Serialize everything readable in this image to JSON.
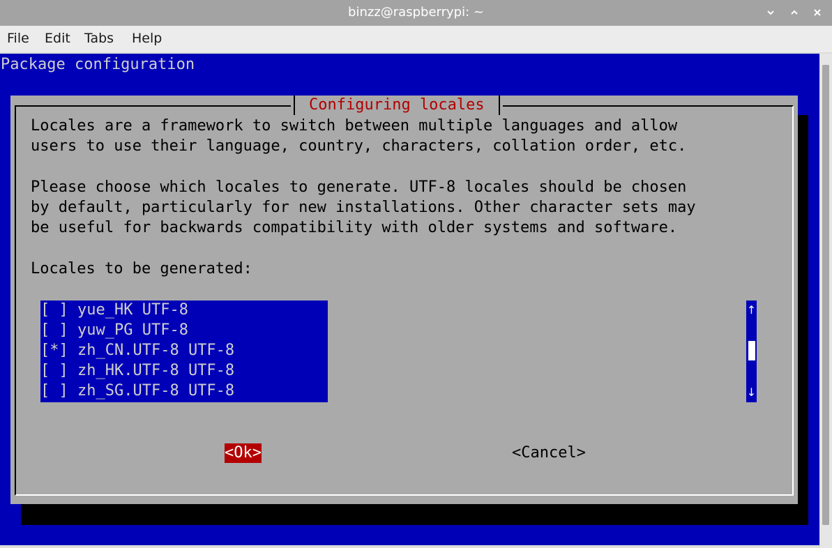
{
  "window": {
    "title": "binzz@raspberrypi: ~",
    "controls": [
      "chevron-down-icon",
      "chevron-up-icon",
      "close-icon"
    ]
  },
  "menubar": {
    "items": [
      "File",
      "Edit",
      "Tabs",
      "Help"
    ]
  },
  "terminal": {
    "header": "Package configuration",
    "dialog": {
      "title": "Configuring locales",
      "paragraphs": [
        "Locales are a framework to switch between multiple languages and allow",
        "users to use their language, country, characters, collation order, etc.",
        "Please choose which locales to generate. UTF-8 locales should be chosen",
        "by default, particularly for new installations. Other character sets may",
        "be useful for backwards compatibility with older systems and software."
      ],
      "list_label": "Locales to be generated:",
      "items": [
        {
          "mark": "[ ]",
          "label": "yue_HK UTF-8",
          "checked": false
        },
        {
          "mark": "[ ]",
          "label": "yuw_PG UTF-8",
          "checked": false
        },
        {
          "mark": "[*]",
          "label": "zh_CN.UTF-8 UTF-8",
          "checked": true
        },
        {
          "mark": "[ ]",
          "label": "zh_HK.UTF-8 UTF-8",
          "checked": false
        },
        {
          "mark": "[ ]",
          "label": "zh_SG.UTF-8 UTF-8",
          "checked": false
        }
      ],
      "scroll_up": "↑",
      "scroll_down": "↓",
      "ok_label": "<Ok>",
      "cancel_label": "<Cancel>"
    }
  },
  "colors": {
    "terminal_bg": "#0000b7",
    "dialog_bg": "#aaaaaa",
    "title_red": "#b30000",
    "ok_bg": "#b30000"
  }
}
